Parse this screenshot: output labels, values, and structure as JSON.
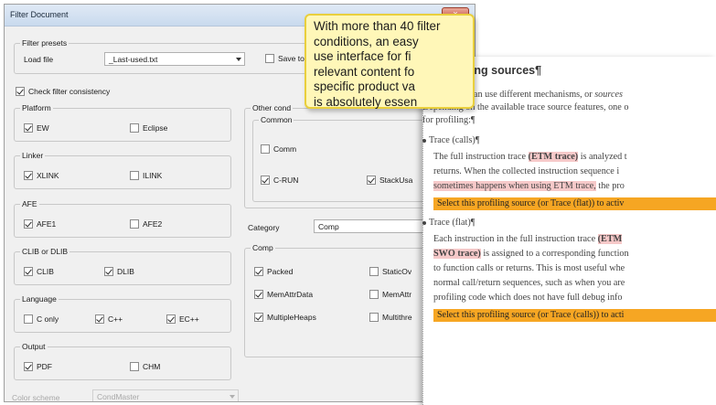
{
  "dialog": {
    "title": "Filter Document",
    "close_label": "x"
  },
  "presets": {
    "group_label": "Filter presets",
    "load_file_label": "Load file",
    "load_file_value": "_Last-used.txt",
    "save_label": "Save to"
  },
  "check_consistency": {
    "label": "Check filter consistency",
    "checked": true
  },
  "platform": {
    "label": "Platform",
    "items": [
      {
        "label": "EW",
        "checked": true
      },
      {
        "label": "Eclipse",
        "checked": false
      }
    ]
  },
  "linker": {
    "label": "Linker",
    "items": [
      {
        "label": "XLINK",
        "checked": true
      },
      {
        "label": "ILINK",
        "checked": false
      }
    ]
  },
  "afe": {
    "label": "AFE",
    "items": [
      {
        "label": "AFE1",
        "checked": true
      },
      {
        "label": "AFE2",
        "checked": false
      }
    ]
  },
  "clib": {
    "label": "CLIB or DLIB",
    "items": [
      {
        "label": "CLIB",
        "checked": true
      },
      {
        "label": "DLIB",
        "checked": true
      }
    ]
  },
  "language": {
    "label": "Language",
    "items": [
      {
        "label": "C only",
        "checked": false
      },
      {
        "label": "C++",
        "checked": true
      },
      {
        "label": "EC++",
        "checked": true
      }
    ]
  },
  "output": {
    "label": "Output",
    "items": [
      {
        "label": "PDF",
        "checked": true
      },
      {
        "label": "CHM",
        "checked": false
      }
    ]
  },
  "color_scheme": {
    "label": "Color scheme",
    "value": "CondMaster"
  },
  "other_conditions": {
    "label": "Other cond",
    "common_label": "Common",
    "items": [
      {
        "label": "Comm",
        "checked": false
      },
      {
        "label": "C-RUN",
        "checked": true
      },
      {
        "label": "StackUsa",
        "checked": true
      }
    ]
  },
  "category": {
    "label": "Category",
    "value": "Comp"
  },
  "comp": {
    "label": "Comp",
    "items": [
      {
        "label": "Packed",
        "checked": true
      },
      {
        "label": "StaticOv",
        "checked": false
      },
      {
        "label": "MemAttrData",
        "checked": true
      },
      {
        "label": "MemAttr",
        "checked": false
      },
      {
        "label": "MultipleHeaps",
        "checked": true
      },
      {
        "label": "Multithre",
        "checked": false
      }
    ]
  },
  "tooltip": {
    "lines": [
      "With more than 40 filter",
      "conditions, an easy",
      "use interface for fi",
      "relevant content fo",
      "specific product va",
      "is absolutely essen"
    ]
  },
  "doc": {
    "title": "Profiling sources¶",
    "p1_a": "The profiler can use different mechanisms, or ",
    "p1_b": "sources",
    "p2": "Depending on the available trace source features, one o",
    "p3": "for profiling:¶",
    "b1_title": "Trace (calls)¶",
    "b1_l1_a": "The full instruction trace ",
    "b1_l1_b": "(ETM trace)",
    "b1_l1_c": " is analyzed t",
    "b1_l2": "returns. When the collected instruction sequence i",
    "b1_l3_a": "sometimes happens when using ETM trace,",
    "b1_l3_b": " the pro",
    "b1_select": "Select this profiling source (or Trace (flat)) to activ",
    "b2_title": "Trace (flat)¶",
    "b2_l1_a": "Each instruction in the full instruction trace ",
    "b2_l1_b": "(ETM",
    "b2_l2_a": "SWO trace)",
    "b2_l2_b": " is assigned to a corresponding function",
    "b2_l3": "to function calls or returns. This is most useful whe",
    "b2_l4": "normal call/return sequences, such as when you are",
    "b2_l5": "profiling code which does not have full debug info",
    "b2_select": "Select this profiling source (or Trace (calls)) to acti"
  }
}
